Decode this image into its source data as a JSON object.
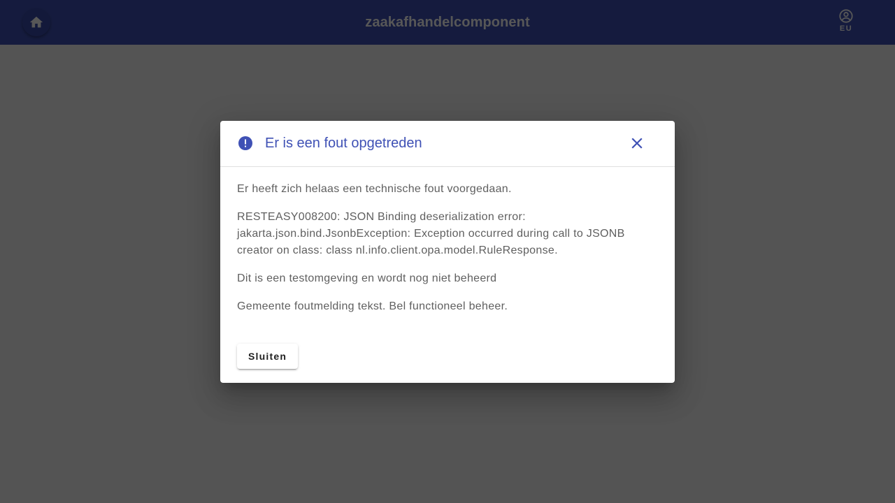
{
  "header": {
    "title": "zaakafhandelcomponent",
    "home_icon": "home-icon",
    "user_icon": "account-circle-icon",
    "user_initials": "EU",
    "background_color": "#3f51b5"
  },
  "dialog": {
    "title": "Er is een fout opgetreden",
    "title_icon": "error-icon",
    "title_color": "#3f51b5",
    "close_icon": "close-icon",
    "paragraphs": [
      "Er heeft zich helaas een technische fout voorgedaan.",
      "RESTEASY008200: JSON Binding deserialization error: jakarta.json.bind.JsonbException: Exception occurred during call to JSONB creator on class: class nl.info.client.opa.model.RuleResponse.",
      "Dit is een testomgeving en wordt nog niet beheerd",
      "Gemeente foutmelding tekst. Bel functioneel beheer."
    ],
    "close_button_label": "Sluiten"
  }
}
